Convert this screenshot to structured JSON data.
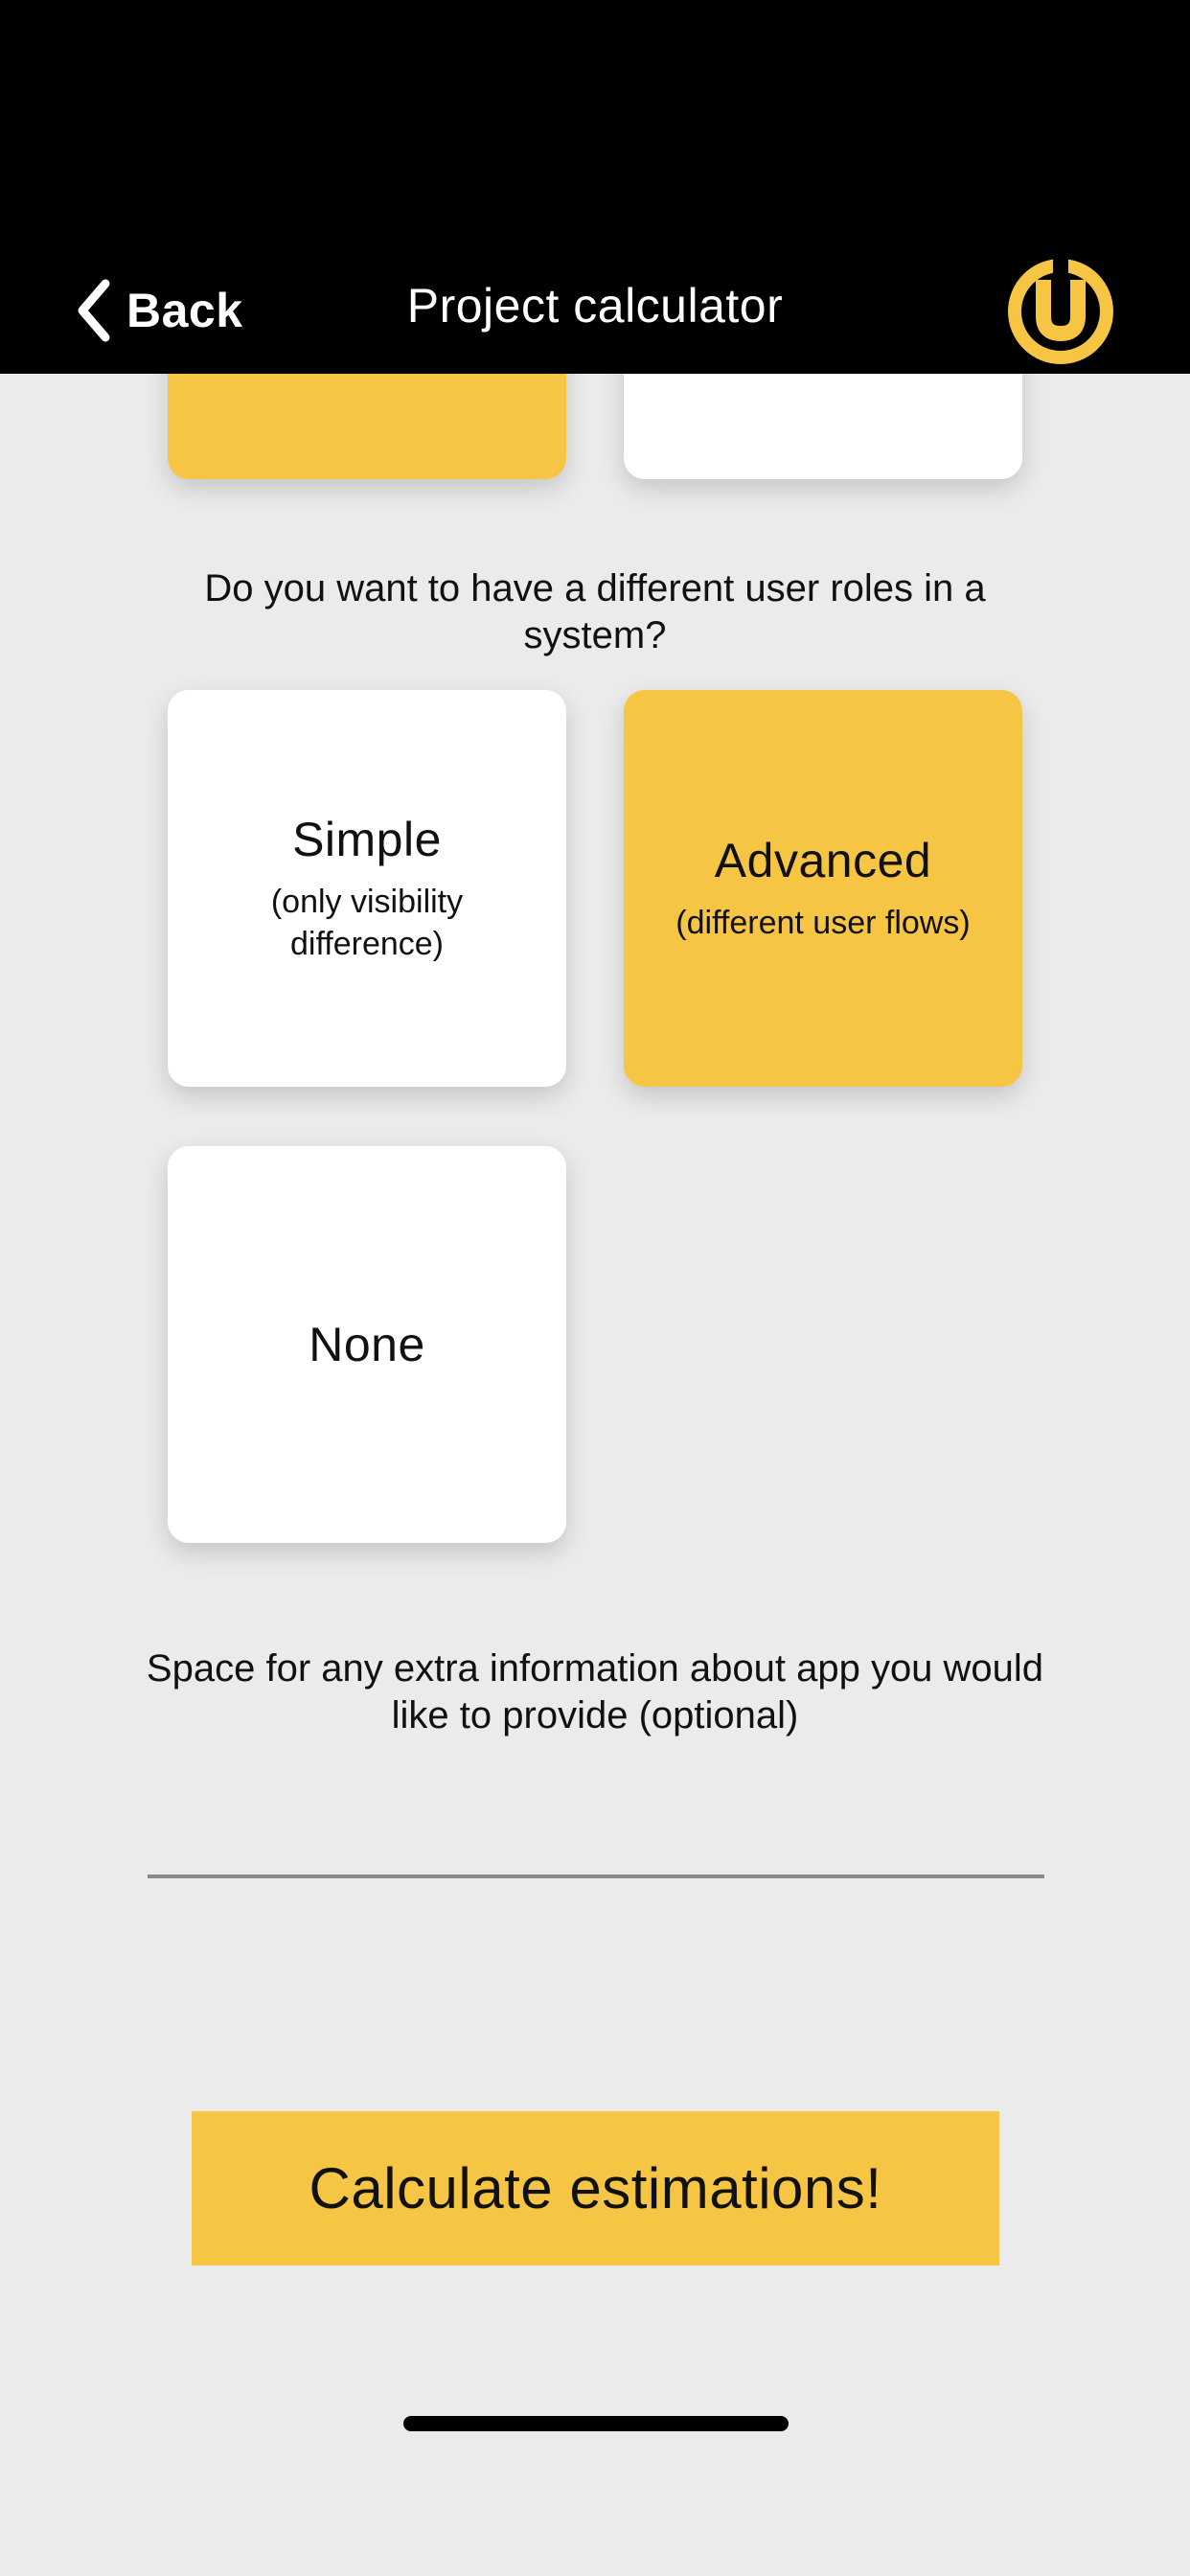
{
  "header": {
    "back_label": "Back",
    "title": "Project calculator",
    "logo_icon": "u-logo-icon",
    "logo_color": "#f5c543",
    "background": "#000000"
  },
  "previous_question": {
    "options": [
      {
        "selected": true
      },
      {
        "selected": false
      }
    ]
  },
  "user_roles": {
    "question": "Do you want to have a different user roles in a system?",
    "options": [
      {
        "title": "Simple",
        "subtitle": "(only visibility difference)",
        "selected": false
      },
      {
        "title": "Advanced",
        "subtitle": "(different user flows)",
        "selected": true
      },
      {
        "title": "None",
        "subtitle": "",
        "selected": false
      }
    ]
  },
  "extra_info": {
    "label": "Space for any extra information about app you would like to provide (optional)",
    "value": "",
    "placeholder": ""
  },
  "calculate_button": {
    "label": "Calculate estimations!"
  },
  "colors": {
    "accent": "#f5c543",
    "background": "#ebebeb",
    "card": "#ffffff"
  }
}
